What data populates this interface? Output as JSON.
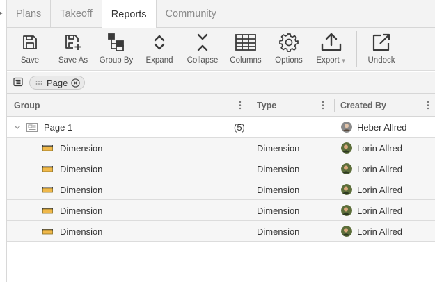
{
  "tabs": [
    {
      "label": "Plans",
      "active": false
    },
    {
      "label": "Takeoff",
      "active": false
    },
    {
      "label": "Reports",
      "active": true
    },
    {
      "label": "Community",
      "active": false
    }
  ],
  "toolbar": {
    "save": "Save",
    "save_as": "Save As",
    "group_by": "Group By",
    "expand": "Expand",
    "collapse": "Collapse",
    "columns": "Columns",
    "options": "Options",
    "export": "Export",
    "undock": "Undock"
  },
  "group_panel": {
    "chip_label": "Page"
  },
  "grid": {
    "columns": {
      "group": "Group",
      "type": "Type",
      "created_by": "Created By"
    },
    "group_row": {
      "name": "Page 1",
      "count": "(5)",
      "created_by": "Heber Allred"
    },
    "rows": [
      {
        "name": "Dimension",
        "type": "Dimension",
        "created_by": "Lorin Allred"
      },
      {
        "name": "Dimension",
        "type": "Dimension",
        "created_by": "Lorin Allred"
      },
      {
        "name": "Dimension",
        "type": "Dimension",
        "created_by": "Lorin Allred"
      },
      {
        "name": "Dimension",
        "type": "Dimension",
        "created_by": "Lorin Allred"
      },
      {
        "name": "Dimension",
        "type": "Dimension",
        "created_by": "Lorin Allred"
      }
    ]
  },
  "colors": {
    "chrome_bg": "#f3f3f3",
    "icon": "#3a3a3a",
    "dimension_icon": "#d4a017"
  }
}
